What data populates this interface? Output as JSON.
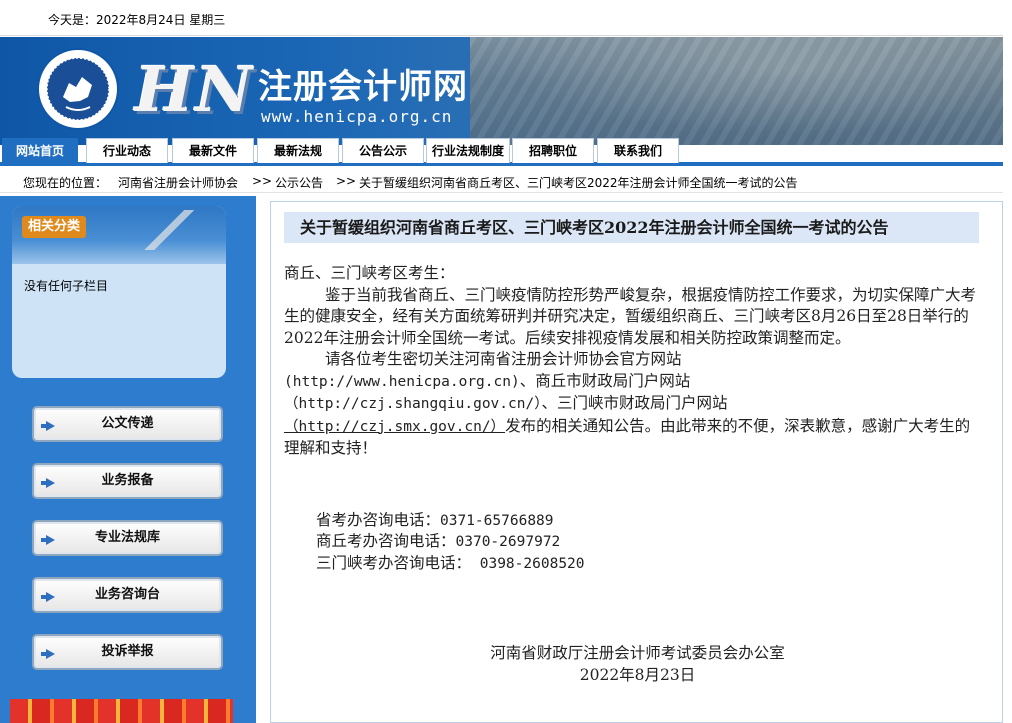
{
  "topbar": {
    "date": "今天是：2022年8月24日  星期三"
  },
  "banner": {
    "title": "注册会计师网",
    "url": "www.henicpa.org.cn",
    "logo_text": "HN",
    "logo_icon": "cpa-emblem-icon"
  },
  "nav": {
    "items": [
      {
        "label": "网站首页",
        "active": true
      },
      {
        "label": "行业动态"
      },
      {
        "label": "最新文件"
      },
      {
        "label": "最新法规"
      },
      {
        "label": "公告公示"
      },
      {
        "label": "行业法规制度"
      },
      {
        "label": "招聘职位"
      },
      {
        "label": "联系我们"
      }
    ]
  },
  "breadcrumb": {
    "prefix": "您现在的位置：",
    "items": [
      "河南省注册会计师协会",
      "公示公告",
      "关于暂缓组织河南省商丘考区、三门峡考区2022年注册会计师全国统一考试的公告"
    ],
    "separator": ">>"
  },
  "sidebar": {
    "panel_title": "相关分类",
    "panel_empty": "没有任何子栏目",
    "buttons": [
      "公文传递",
      "业务报备",
      "专业法规库",
      "业务咨询台",
      "投诉举报"
    ]
  },
  "article": {
    "title": "关于暂缓组织河南省商丘考区、三门峡考区2022年注册会计师全国统一考试的公告",
    "greeting": "商丘、三门峡考区考生：",
    "para1": "鉴于当前我省商丘、三门峡疫情防控形势严峻复杂，根据疫情防控工作要求，为切实保障广大考生的健康安全，经有关方面统筹研判并研究决定，暂缓组织商丘、三门峡考区8月26日至28日举行的2022年注册会计师全国统一考试。后续安排视疫情发展和相关防控政策调整而定。",
    "para2_a": "请各位考生密切关注河南省注册会计师协会官方网站",
    "link1": "(http://www.henicpa.org.cn)",
    "para2_b": "、商丘市财政局门户网站",
    "link2": "（http://czj.shangqiu.gov.cn/）",
    "para2_c": "、三门峡市财政局门户网站",
    "link3": "（http://czj.smx.gov.cn/）",
    "para2_d": "发布的相关通知公告。由此带来的不便，深表歉意，感谢广大考生的理解和支持！",
    "tel1_label": "省考办咨询电话：",
    "tel1": "0371-65766889",
    "tel2_label": "商丘考办咨询电话：",
    "tel2": "0370-2697972",
    "tel3_label": "三门峡考办咨询电话：",
    "tel3": " 0398-2608520",
    "signature": "河南省财政厅注册会计师考试委员会办公室",
    "sign_date": "2022年8月23日"
  },
  "colors": {
    "nav_active": "#1f6ec2",
    "sidebar_bg": "#2e7ccd",
    "title_bar": "#dbe6f6",
    "badge": "#e08a1e"
  }
}
